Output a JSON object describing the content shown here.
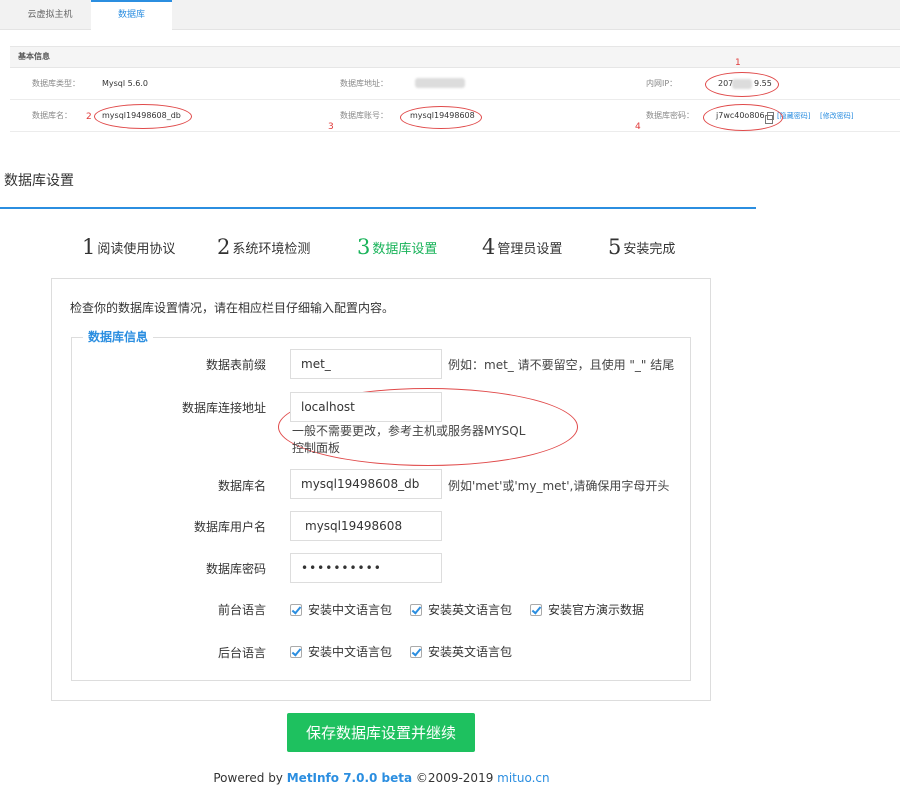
{
  "top_tabs": [
    "云虚拟主机",
    "数据库"
  ],
  "basic_info": {
    "heading": "基本信息",
    "db_type_label": "数据库类型：",
    "db_type_value": "Mysql 5.6.0",
    "db_address_label": "数据库地址：",
    "intranet_ip_label": "内网IP：",
    "intranet_ip_prefix": "207.",
    "intranet_ip_suffix": "9.55",
    "db_name_label": "数据库名：",
    "db_name_value": "mysql19498608_db",
    "db_account_label": "数据库账号：",
    "db_account_value": "mysql19498608",
    "db_password_label": "数据库密码：",
    "db_password_value": "j7wc40o806",
    "hide_password_link": "[隐藏密码]",
    "change_password_link": "[修改密码]"
  },
  "annotations": [
    "1",
    "2",
    "3",
    "4"
  ],
  "annotation_color": "#e04a4a",
  "setup": {
    "title": "数据库设置",
    "steps": [
      {
        "num": "1",
        "label": "阅读使用协议"
      },
      {
        "num": "2",
        "label": "系统环境检测"
      },
      {
        "num": "3",
        "label": "数据库设置"
      },
      {
        "num": "4",
        "label": "管理员设置"
      },
      {
        "num": "5",
        "label": "安装完成"
      }
    ],
    "active_step": 3,
    "active_color": "#19b35a",
    "accent_color": "#2b8ee0"
  },
  "form": {
    "description": "检查你的数据库设置情况，请在相应栏目仔细输入配置内容。",
    "legend": "数据库信息",
    "table_prefix": {
      "label": "数据表前缀",
      "value": "met_",
      "hint": "例如：met_ 请不要留空，且使用 \"_\" 结尾"
    },
    "host": {
      "label": "数据库连接地址",
      "value": "localhost",
      "hint_line1": "一般不需要更改，参考主机或服务器MYSQL",
      "hint_line2": "控制面板"
    },
    "db_name": {
      "label": "数据库名",
      "value": "mysql19498608_db",
      "hint": "例如'met'或'my_met',请确保用字母开头"
    },
    "db_user": {
      "label": "数据库用户名",
      "value": "mysql19498608"
    },
    "db_password": {
      "label": "数据库密码",
      "value": "••••••••••"
    },
    "front_lang": {
      "label": "前台语言",
      "options": [
        "安装中文语言包",
        "安装英文语言包",
        "安装官方演示数据"
      ]
    },
    "back_lang": {
      "label": "后台语言",
      "options": [
        "安装中文语言包",
        "安装英文语言包"
      ]
    },
    "submit_label": "保存数据库设置并继续",
    "submit_color": "#1ec15f"
  },
  "footer": {
    "prefix": "Powered by ",
    "brand": "MetInfo 7.0.0 beta",
    "copyright": " ©2009-2019 ",
    "site": "mituo.cn"
  }
}
